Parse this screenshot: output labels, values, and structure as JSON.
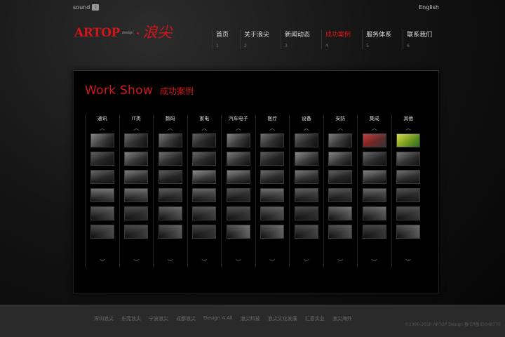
{
  "topbar": {
    "sound_label": "sound",
    "sound_icon": "speaker-icon",
    "language": "English"
  },
  "logo": {
    "text": "ARTOP",
    "sub": "design",
    "cn": "浪尖"
  },
  "nav": [
    {
      "label": "首页",
      "num": "1"
    },
    {
      "label": "关于浪尖",
      "num": "2"
    },
    {
      "label": "新闻动态",
      "num": "3"
    },
    {
      "label": "成功案例",
      "num": "4",
      "active": true
    },
    {
      "label": "服务体系",
      "num": "5"
    },
    {
      "label": "联系我们",
      "num": "6"
    }
  ],
  "panel": {
    "title_en": "Work Show",
    "title_cn": "成功案例",
    "columns": [
      "通讯",
      "IT类",
      "数码",
      "家电",
      "汽车电子",
      "医疗",
      "设备",
      "安防",
      "集成",
      "其他"
    ]
  },
  "footer": {
    "links": [
      "深圳浪尖",
      "东莞浪尖",
      "宁波浪尖",
      "成都浪尖",
      "Design 4 All",
      "浪尖科技",
      "浪尖文化发展",
      "汇意实业",
      "浪尖海外"
    ],
    "copyright": "©1999-2010 ARTOP Design 备ICP备05048770"
  },
  "colors": {
    "brand_red": "#d4161b",
    "background": "#0a0a0a",
    "footer": "#2a2a2a"
  }
}
